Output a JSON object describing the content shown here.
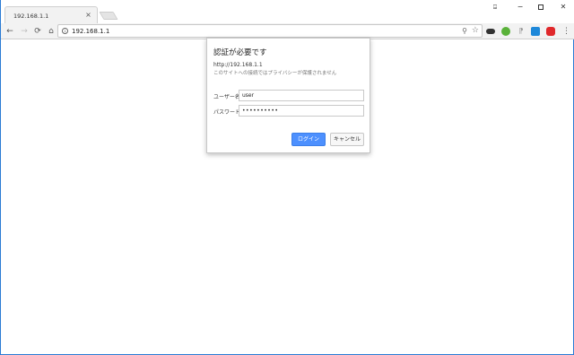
{
  "window": {
    "tab_title": "192.168.1.1",
    "tab_close_glyph": "×",
    "user_glyph": "⍈",
    "minimize_glyph": "−",
    "close_glyph": "✕"
  },
  "toolbar": {
    "back_glyph": "←",
    "forward_glyph": "→",
    "reload_glyph": "⟳",
    "home_glyph": "⌂",
    "info_glyph": "i",
    "url": "192.168.1.1",
    "zoom_glyph": "⚲",
    "star_glyph": "☆",
    "menu_glyph": "⋮",
    "extension_3_glyph": "⁋"
  },
  "dialog": {
    "title": "認証が必要です",
    "url": "http://192.168.1.1",
    "note": "このサイトへの接続ではプライバシーが保護されません",
    "username_label": "ユーザー名",
    "username_value": "user",
    "password_label": "パスワード",
    "password_value": "••••••••••",
    "login_label": "ログイン",
    "cancel_label": "キャンセル"
  },
  "colors": {
    "accent": "#4d90fe",
    "frame": "#2b7bd4"
  }
}
